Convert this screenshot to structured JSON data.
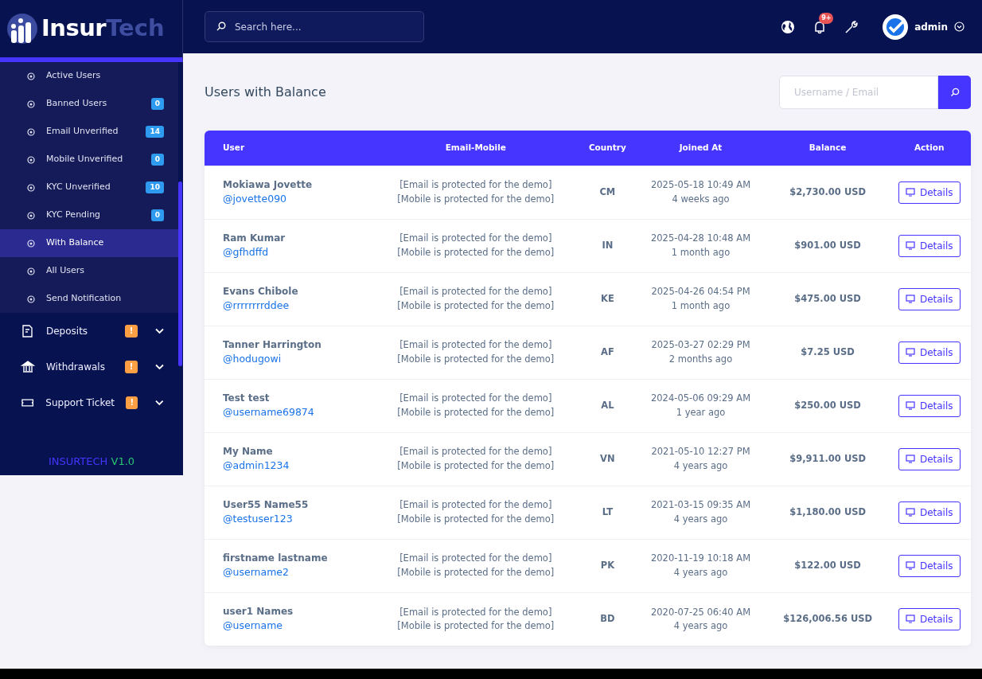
{
  "brand": {
    "logo_text": "Insur",
    "logo_accent": "Tech"
  },
  "sidebar": {
    "submenu": [
      {
        "label": "Active Users",
        "selected": false
      },
      {
        "label": "Banned Users",
        "badge": "0",
        "selected": false
      },
      {
        "label": "Email Unverified",
        "badge": "14",
        "selected": false
      },
      {
        "label": "Mobile Unverified",
        "badge": "0",
        "selected": false
      },
      {
        "label": "KYC Unverified",
        "badge": "10",
        "selected": false
      },
      {
        "label": "KYC Pending",
        "badge": "0",
        "selected": false
      },
      {
        "label": "With Balance",
        "selected": true
      },
      {
        "label": "All Users",
        "selected": false
      },
      {
        "label": "Send Notification",
        "selected": false
      }
    ],
    "menu": [
      {
        "label": "Deposits",
        "kind": "deposit",
        "badge": "!"
      },
      {
        "label": "Withdrawals",
        "kind": "bank",
        "badge": "!"
      },
      {
        "label": "Support Ticket",
        "kind": "ticket",
        "badge": "!"
      }
    ],
    "version": {
      "name": "INSURTECH",
      "number": "V1.0"
    }
  },
  "topbar": {
    "search": {
      "placeholder": "Search here..."
    },
    "notification_count": "9+",
    "user": "admin"
  },
  "page": {
    "title": "Users with Balance",
    "search": {
      "placeholder": "Username / Email"
    }
  },
  "table": {
    "columns": [
      "User",
      "Email-Mobile",
      "Country",
      "Joined At",
      "Balance",
      "Action"
    ],
    "rows": [
      {
        "name": "Mokiawa Jovette",
        "username": "@jovette090",
        "email": "[Email is protected for the demo]",
        "mobile": "[Mobile is protected for the demo]",
        "country": "CM",
        "joined": "2025-05-18 10:49 AM",
        "ago": "4 weeks ago",
        "balance": "$2,730.00 USD",
        "action": "Details"
      },
      {
        "name": "Ram Kumar",
        "username": "@gfhdffd",
        "email": "[Email is protected for the demo]",
        "mobile": "[Mobile is protected for the demo]",
        "country": "IN",
        "joined": "2025-04-28 10:48 AM",
        "ago": "1 month ago",
        "balance": "$901.00 USD",
        "action": "Details"
      },
      {
        "name": "Evans Chibole",
        "username": "@rrrrrrrrddee",
        "email": "[Email is protected for the demo]",
        "mobile": "[Mobile is protected for the demo]",
        "country": "KE",
        "joined": "2025-04-26 04:54 PM",
        "ago": "1 month ago",
        "balance": "$475.00 USD",
        "action": "Details"
      },
      {
        "name": "Tanner Harrington",
        "username": "@hodugowi",
        "email": "[Email is protected for the demo]",
        "mobile": "[Mobile is protected for the demo]",
        "country": "AF",
        "joined": "2025-03-27 02:29 PM",
        "ago": "2 months ago",
        "balance": "$7.25 USD",
        "action": "Details"
      },
      {
        "name": "Test test",
        "username": "@username69874",
        "email": "[Email is protected for the demo]",
        "mobile": "[Mobile is protected for the demo]",
        "country": "AL",
        "joined": "2024-05-06 09:29 AM",
        "ago": "1 year ago",
        "balance": "$250.00 USD",
        "action": "Details"
      },
      {
        "name": "My Name",
        "username": "@admin1234",
        "email": "[Email is protected for the demo]",
        "mobile": "[Mobile is protected for the demo]",
        "country": "VN",
        "joined": "2021-05-10 12:27 PM",
        "ago": "4 years ago",
        "balance": "$9,911.00 USD",
        "action": "Details"
      },
      {
        "name": "User55 Name55",
        "username": "@testuser123",
        "email": "[Email is protected for the demo]",
        "mobile": "[Mobile is protected for the demo]",
        "country": "LT",
        "joined": "2021-03-15 09:35 AM",
        "ago": "4 years ago",
        "balance": "$1,180.00 USD",
        "action": "Details"
      },
      {
        "name": "firstname lastname",
        "username": "@username2",
        "email": "[Email is protected for the demo]",
        "mobile": "[Mobile is protected for the demo]",
        "country": "PK",
        "joined": "2020-11-19 10:18 AM",
        "ago": "4 years ago",
        "balance": "$122.00 USD",
        "action": "Details"
      },
      {
        "name": "user1 Names",
        "username": "@username",
        "email": "[Email is protected for the demo]",
        "mobile": "[Mobile is protected for the demo]",
        "country": "BD",
        "joined": "2020-07-25 06:40 AM",
        "ago": "4 years ago",
        "balance": "$126,006.56 USD",
        "action": "Details"
      }
    ]
  }
}
